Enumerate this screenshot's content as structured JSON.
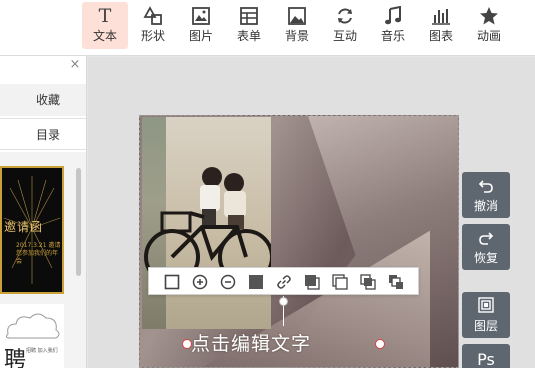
{
  "toolbar": {
    "items": [
      {
        "label": "文本",
        "icon": "text-icon",
        "active": true
      },
      {
        "label": "形状",
        "icon": "shape-icon"
      },
      {
        "label": "图片",
        "icon": "image-icon"
      },
      {
        "label": "表单",
        "icon": "form-icon"
      },
      {
        "label": "背景",
        "icon": "background-icon"
      },
      {
        "label": "互动",
        "icon": "interact-icon"
      },
      {
        "label": "音乐",
        "icon": "music-icon"
      },
      {
        "label": "图表",
        "icon": "chart-icon"
      },
      {
        "label": "动画",
        "icon": "animation-icon"
      }
    ],
    "text_glyph": "T",
    "accent_color": "#fde1d8"
  },
  "left_panel": {
    "close_glyph": "×",
    "tabs": {
      "collect": "收藏",
      "directory": "目录"
    },
    "thumbs": [
      {
        "title": "邀请函",
        "sub": "2017.3.21\n邀请您参加我们的年会"
      },
      {
        "title": "聘",
        "sub": "招聘\n加入我们"
      }
    ]
  },
  "text_toolbar": {
    "buttons": [
      "border-icon",
      "zoom-in-icon",
      "zoom-out-icon",
      "fill-icon",
      "link-icon",
      "layer-up-icon",
      "layer-down-icon",
      "bring-front-icon",
      "send-back-icon"
    ]
  },
  "canvas": {
    "text_content": "点击编辑文字"
  },
  "right_buttons": [
    {
      "label": "撤消",
      "icon": "undo-icon"
    },
    {
      "label": "恢复",
      "icon": "redo-icon"
    },
    {
      "label": "图层",
      "icon": "layers-icon"
    },
    {
      "label": "Ps",
      "icon": "ps-icon"
    }
  ]
}
